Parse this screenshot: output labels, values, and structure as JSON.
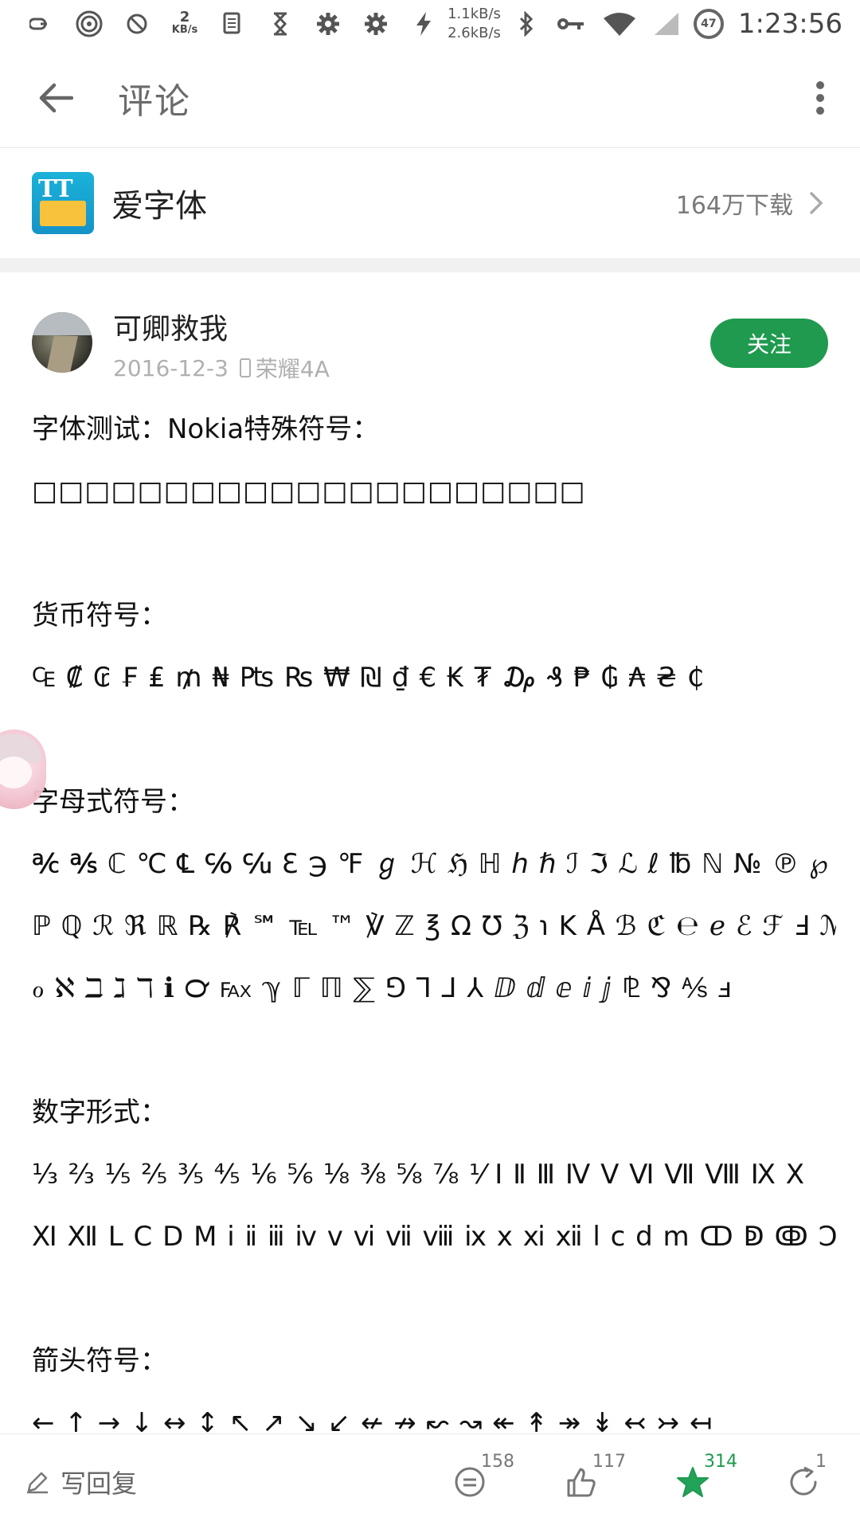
{
  "status_bar": {
    "kbs_num": "2",
    "kbs_unit": "KB/s",
    "speed_up": "1.1kB/s",
    "speed_down": "2.6kB/s",
    "battery": "47",
    "time": "1:23:56"
  },
  "toolbar": {
    "title": "评论"
  },
  "app": {
    "name": "爱字体",
    "downloads": "164万下载"
  },
  "comment": {
    "username": "可卿救我",
    "date": "2016-12-3",
    "device": "荣耀4A",
    "follow_label": "关注",
    "lines": [
      "字体测试：Nokia特殊符号：",
      "□□□□□□□□□□□□□□□□□□□□□",
      "",
      "货币符号：",
      "₠ ₡ ₢ ₣ ₤ ₥ ₦ ₧ ₨ ₩ ₪ ₫ € ₭ ₮ ₯ ₰ ₱ ₲ ₳ ₴ ₵",
      "",
      "字母式符号：",
      "℀ ℁ ℂ ℃ ℄ ℅ ℆ ℇ ℈ ℉ ℊ ℋ ℌ ℍ ℎ ℏ ℐ ℑ ℒ ℓ ℔ ℕ № ℗ ℘",
      "ℙ ℚ ℛ ℜ ℝ ℞ ℟ ℠ ℡ ™ ℣ ℤ ℥ Ω ℧ ℨ ℩ K Å ℬ ℭ ℮ ℯ ℰ ℱ Ⅎ ℳ",
      "ℴ ℵ ℶ ℷ ℸ ℹ ℺ ℻ ℽ ℾ ℿ ⅀ ⅁ ⅂ ⅃ ⅄ ⅅ ⅆ ⅇ ⅈ ⅉ ⅊ ⅋ ⅍ ⅎ",
      "",
      "数字形式：",
      "⅓ ⅔ ⅕ ⅖ ⅗ ⅘ ⅙ ⅚ ⅛ ⅜ ⅝ ⅞ ⅟ Ⅰ Ⅱ Ⅲ Ⅳ Ⅴ Ⅵ Ⅶ Ⅷ Ⅸ Ⅹ",
      "Ⅺ Ⅻ Ⅼ Ⅽ Ⅾ Ⅿ ⅰ ⅱ ⅲ ⅳ ⅴ ⅵ ⅶ ⅷ ⅸ ⅹ ⅺ ⅻ ⅼ ⅽ ⅾ ⅿ ↀ ↁ ↂ Ↄ",
      "",
      "箭头符号：",
      "← ↑ → ↓ ↔ ↕ ↖ ↗ ↘ ↙ ↚ ↛ ↜ ↝ ↞ ↟ ↠ ↡ ↢ ↣ ↤"
    ]
  },
  "bottom_bar": {
    "reply_label": "写回复",
    "comments_count": "158",
    "likes_count": "117",
    "favorites_count": "314",
    "shares_count": "1"
  },
  "colors": {
    "accent_green": "#1f9a4f",
    "app_icon_blue": "#1ab2d8",
    "app_icon_yellow": "#f9c23c"
  },
  "icons": [
    "link-icon",
    "hotspot-icon",
    "block-icon",
    "document-icon",
    "hourglass-icon",
    "gear-icon",
    "gear-icon",
    "flash-icon",
    "bluetooth-icon",
    "key-icon",
    "wifi-icon",
    "signal-icon",
    "back-arrow-icon",
    "more-vert-icon",
    "chevron-right-icon",
    "pencil-icon",
    "comment-icon",
    "thumb-up-icon",
    "star-icon",
    "share-icon"
  ]
}
